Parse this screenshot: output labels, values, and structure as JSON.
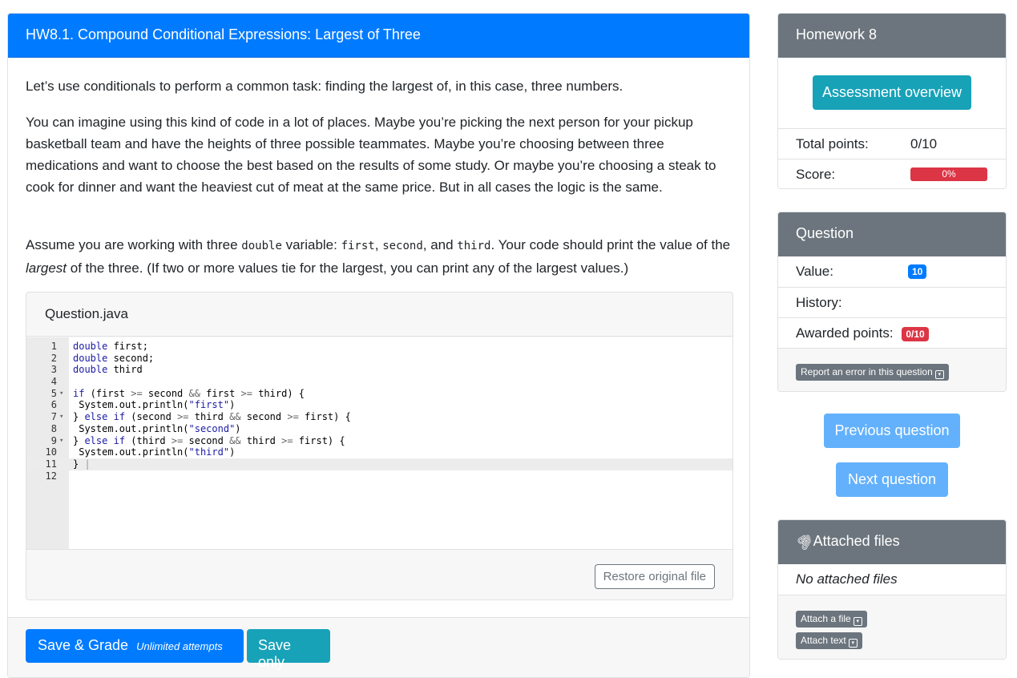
{
  "question": {
    "title": "HW8.1. Compound Conditional Expressions: Largest of Three",
    "p1": "Let’s use conditionals to perform a common task: finding the largest of, in this case, three numbers.",
    "p2": "You can imagine using this kind of code in a lot of places. Maybe you’re picking the next person for your pickup basketball team and have the heights of three possible teammates. Maybe you’re choosing between three medications and want to choose the best based on the results of some study. Or maybe you’re choosing a steak to cook for dinner and want the heaviest cut of meat at the same price. But in all cases the logic is the same.",
    "p3_a": "Assume you are working with three ",
    "p3_code_double": "double",
    "p3_b": " variable: ",
    "p3_code_first": "first",
    "p3_c": ", ",
    "p3_code_second": "second",
    "p3_d": ", and ",
    "p3_code_third": "third",
    "p3_e": ". Your code should print the value of the ",
    "p3_largest": "largest",
    "p3_f": " of the three. (If two or more values tie for the largest, you can print any of the largest values.)"
  },
  "editor": {
    "filename": "Question.java",
    "restore_label": "Restore original file",
    "line_numbers": [
      "1",
      "2",
      "3",
      "4",
      "5",
      "6",
      "7",
      "8",
      "9",
      "10",
      "11",
      "12"
    ]
  },
  "footer": {
    "save_grade_label": "Save & Grade",
    "attempts_label": "Unlimited attempts",
    "save_only_label": "Save only"
  },
  "homework": {
    "title": "Homework 8",
    "overview_label": "Assessment overview",
    "total_points_label": "Total points:",
    "total_points_value": "0/10",
    "score_label": "Score:",
    "score_value": "0%",
    "score_fraction": 0
  },
  "question_panel": {
    "title": "Question",
    "value_label": "Value:",
    "value": "10",
    "history_label": "History:",
    "awarded_label": "Awarded points:",
    "awarded_value": "0/10",
    "report_label": "Report an error in this question"
  },
  "navigation": {
    "previous_label": "Previous question",
    "next_label": "Next question"
  },
  "files": {
    "title": "Attached files",
    "empty_label": "No attached files",
    "attach_file_label": "Attach a file",
    "attach_text_label": "Attach text"
  },
  "colors": {
    "primary": "#007bff",
    "info": "#17a2b8",
    "secondary": "#6c757d",
    "danger": "#dc3545"
  }
}
